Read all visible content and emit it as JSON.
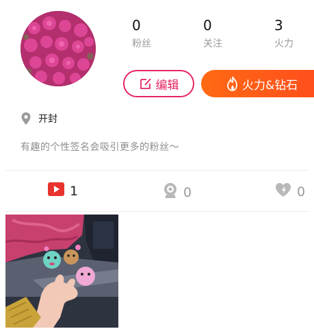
{
  "profile": {
    "stats": [
      {
        "value": "0",
        "label": "粉丝"
      },
      {
        "value": "0",
        "label": "关注"
      },
      {
        "value": "3",
        "label": "火力"
      }
    ],
    "edit_button_label": "编辑",
    "fire_button_label": "火力&钻石",
    "location": "开封",
    "signature": "有趣的个性签名会吸引更多的粉丝～"
  },
  "tabs": [
    {
      "icon": "video-play-icon",
      "count": "1"
    },
    {
      "icon": "camera-icon",
      "count": "0"
    },
    {
      "icon": "heart-icon",
      "count": "0"
    }
  ],
  "colors": {
    "accent": "#e5255f",
    "fire_gradient_start": "#ff6a14",
    "fire_gradient_end": "#ff4d1c",
    "video_icon": "#e8332e"
  }
}
